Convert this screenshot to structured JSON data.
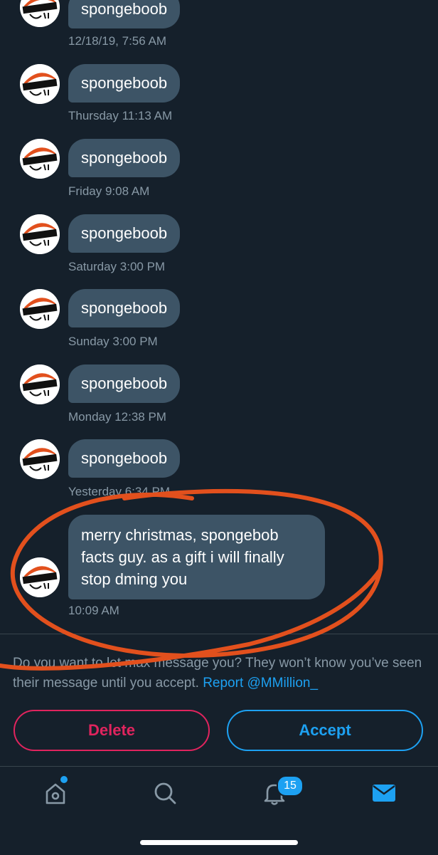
{
  "messages": [
    {
      "text": "spongeboob",
      "time": "12/18/19, 7:56 AM"
    },
    {
      "text": "spongeboob",
      "time": "Thursday 11:13 AM"
    },
    {
      "text": "spongeboob",
      "time": "Friday 9:08 AM"
    },
    {
      "text": "spongeboob",
      "time": "Saturday 3:00 PM"
    },
    {
      "text": "spongeboob",
      "time": "Sunday 3:00 PM"
    },
    {
      "text": "spongeboob",
      "time": "Monday 12:38 PM"
    },
    {
      "text": "spongeboob",
      "time": "Yesterday 6:34 PM"
    },
    {
      "text": "merry christmas, spongebob facts guy. as a gift i will finally stop dming you",
      "time": "10:09 AM"
    }
  ],
  "request": {
    "prompt": "Do you want to let max message you? They won’t know you’ve seen their message until you accept.",
    "report_link": "Report @MMillion_",
    "delete_label": "Delete",
    "accept_label": "Accept"
  },
  "tabbar": {
    "items": [
      {
        "icon": "home-icon"
      },
      {
        "icon": "search-icon"
      },
      {
        "icon": "bell-icon"
      },
      {
        "icon": "mail-icon"
      }
    ],
    "notifications_count": "15"
  },
  "colors": {
    "background": "#15202b",
    "bubble": "#3d5466",
    "accent": "#1da1f2",
    "delete": "#e0245e",
    "annotation": "#e2501d"
  }
}
